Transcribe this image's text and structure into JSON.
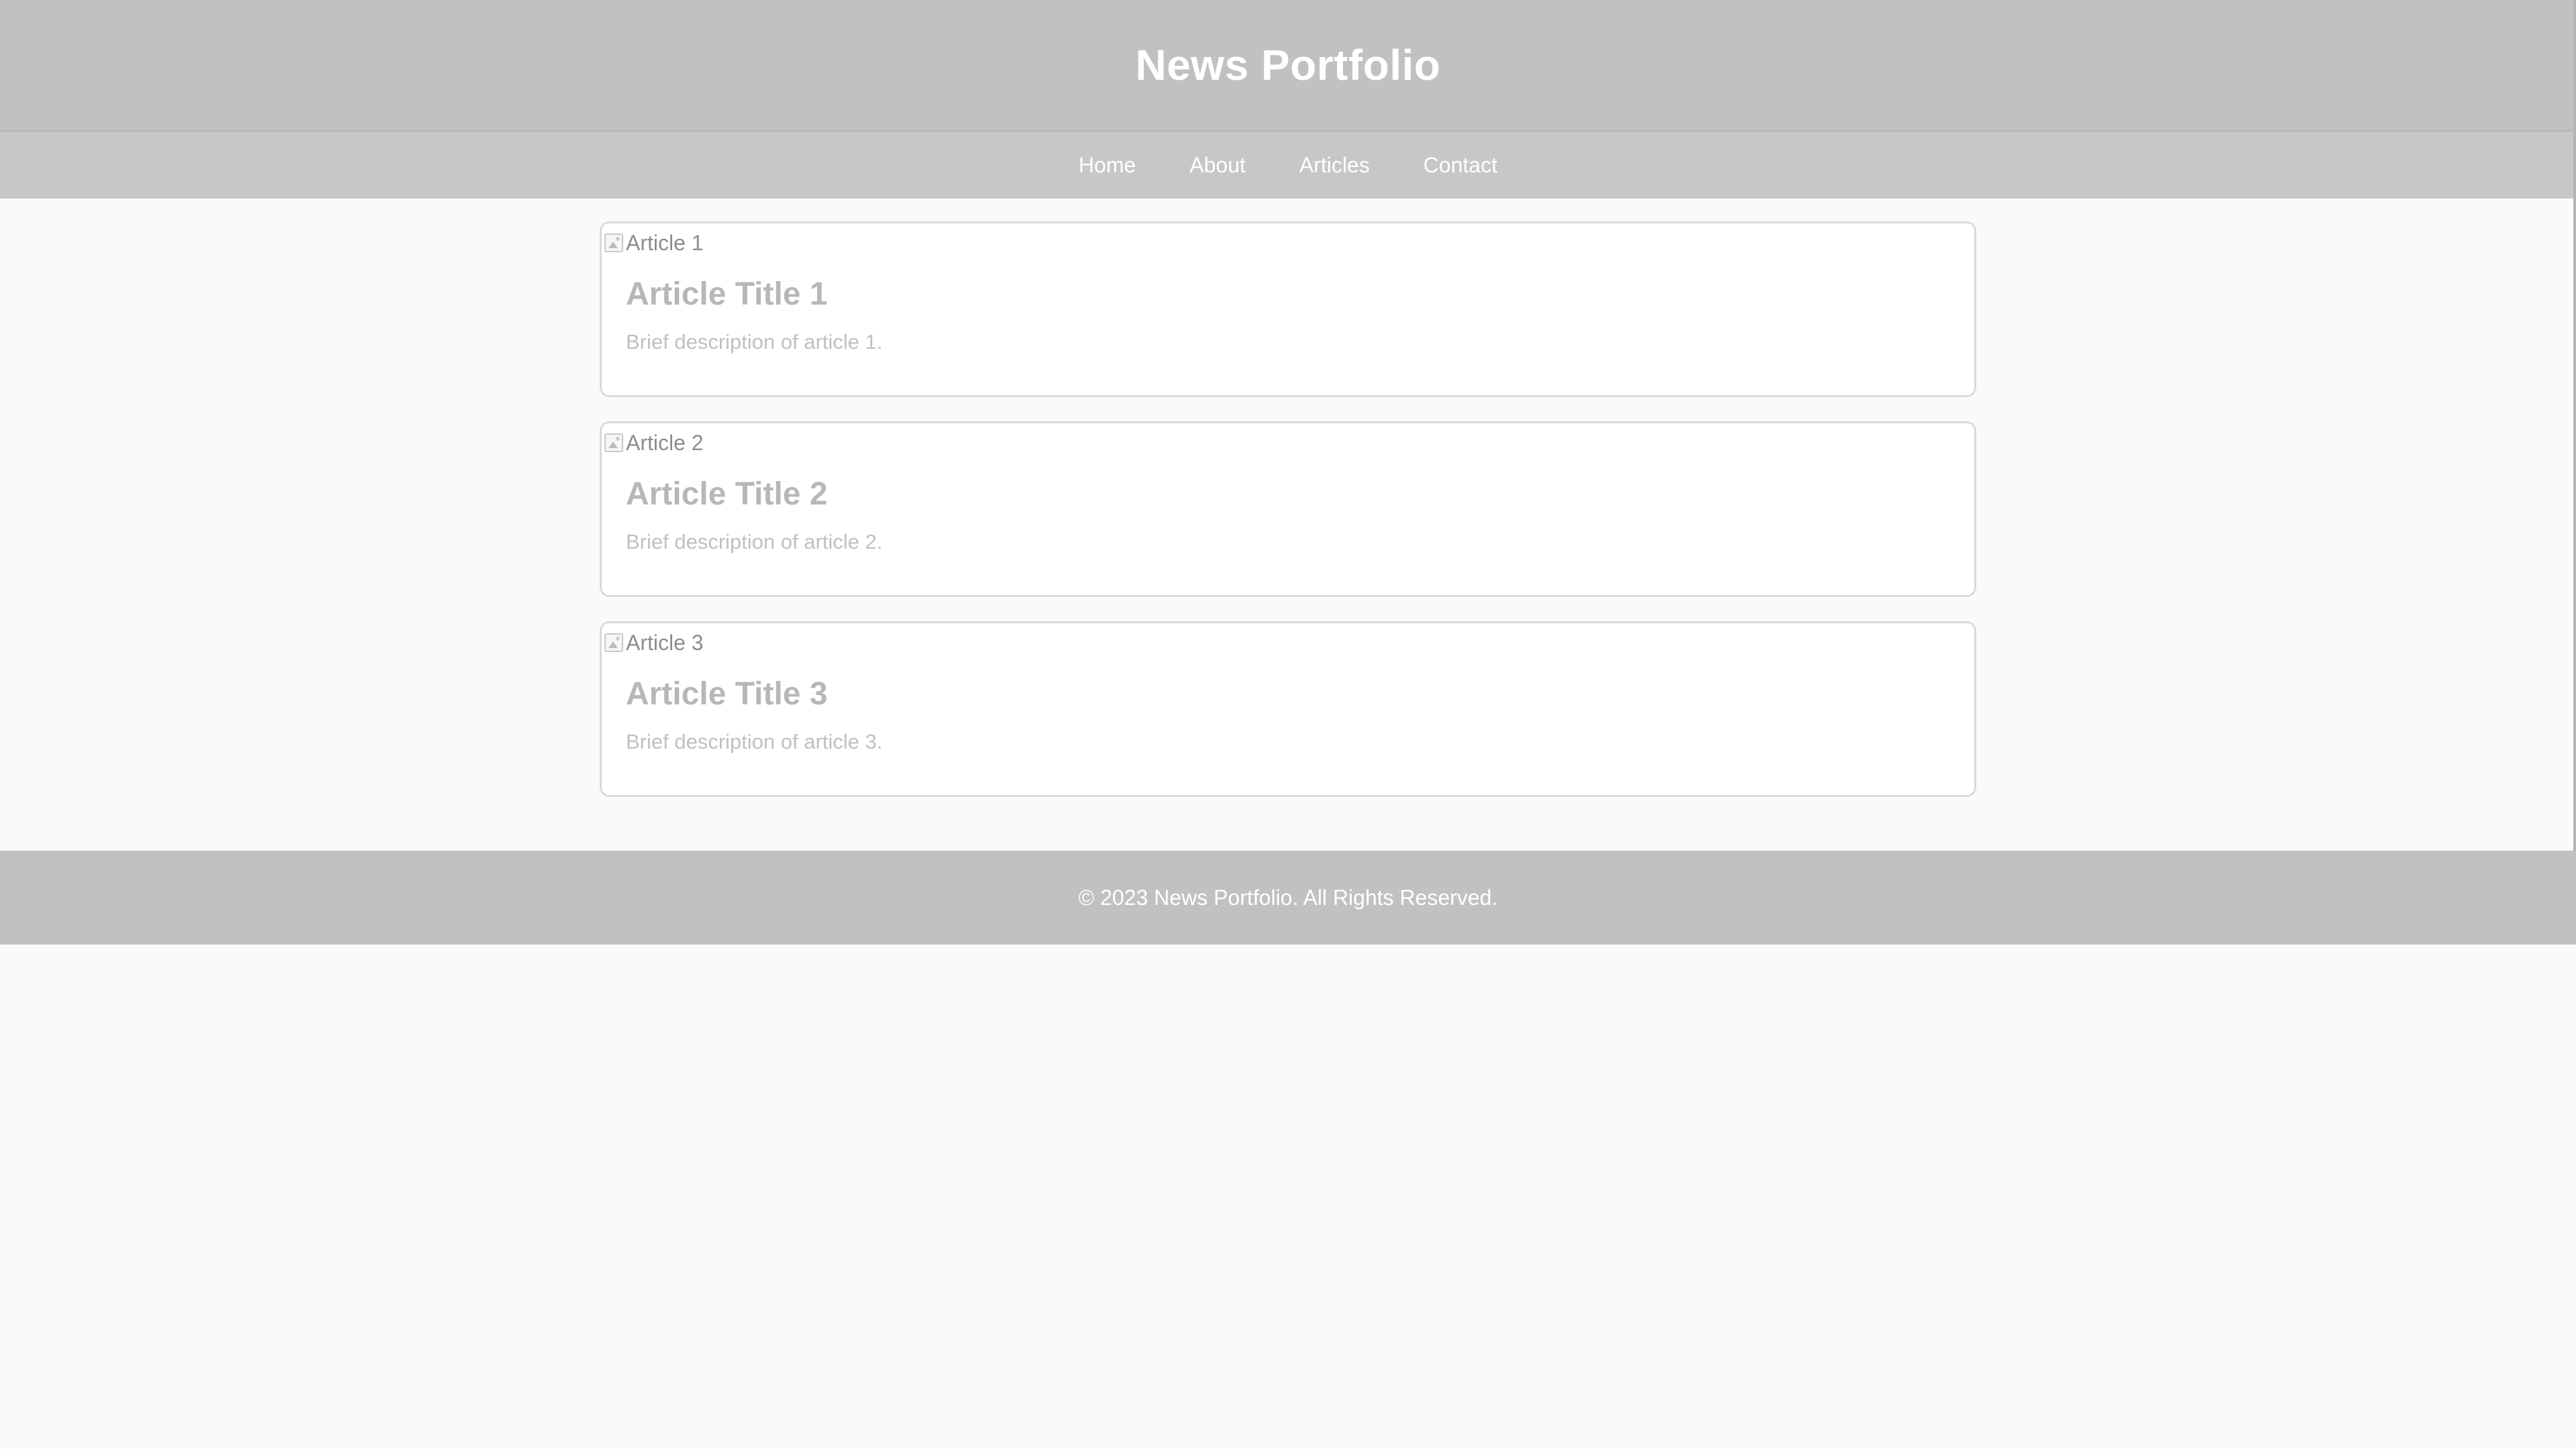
{
  "header": {
    "title": "News Portfolio"
  },
  "nav": {
    "items": [
      {
        "label": "Home"
      },
      {
        "label": "About"
      },
      {
        "label": "Articles"
      },
      {
        "label": "Contact"
      }
    ]
  },
  "articles": [
    {
      "image_alt": "Article 1",
      "title": "Article Title 1",
      "description": "Brief description of article 1."
    },
    {
      "image_alt": "Article 2",
      "title": "Article Title 2",
      "description": "Brief description of article 2."
    },
    {
      "image_alt": "Article 3",
      "title": "Article Title 3",
      "description": "Brief description of article 3."
    }
  ],
  "footer": {
    "text": "© 2023 News Portfolio. All Rights Reserved."
  },
  "colors": {
    "header_bg": "#c1c1c1",
    "nav_bg": "#c7c7c7",
    "page_bg": "#fafafa",
    "card_bg": "#ffffff"
  }
}
